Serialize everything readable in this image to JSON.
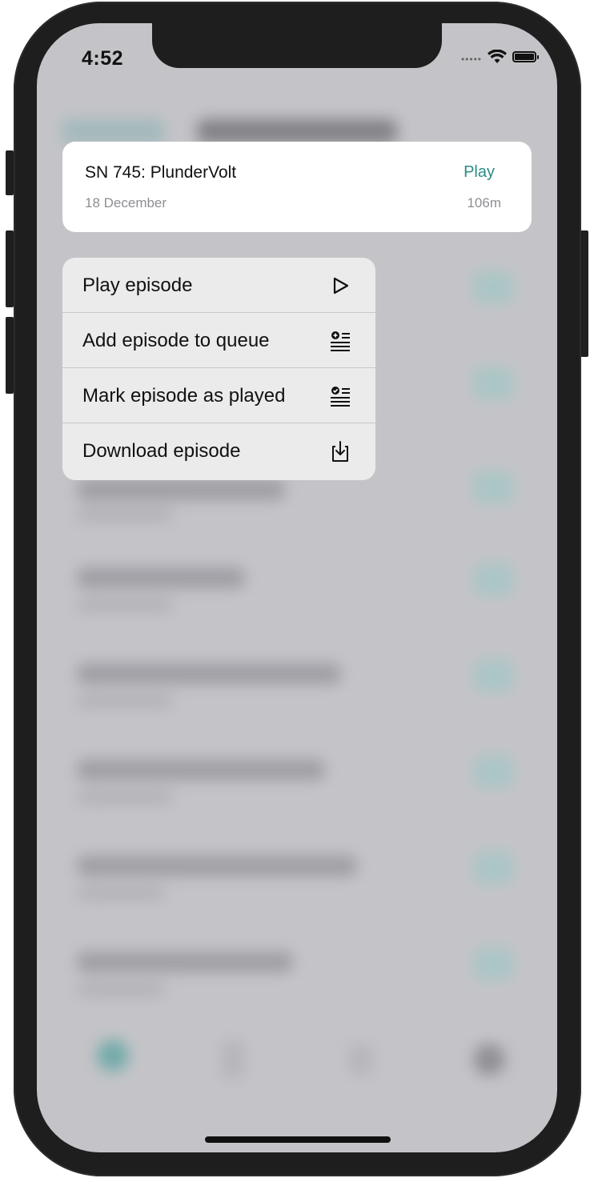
{
  "status_bar": {
    "time": "4:52",
    "signal_icon": "signal-dots-icon",
    "wifi_icon": "wifi-icon",
    "battery_icon": "battery-icon"
  },
  "preview": {
    "title": "SN 745: PlunderVolt",
    "date": "18 December",
    "play_label": "Play",
    "duration": "106m",
    "accent_color": "#2a8c86"
  },
  "menu": {
    "items": [
      {
        "label": "Play episode",
        "icon": "play-outline-icon"
      },
      {
        "label": "Add episode to queue",
        "icon": "add-to-queue-icon"
      },
      {
        "label": "Mark episode as played",
        "icon": "mark-played-icon"
      },
      {
        "label": "Download episode",
        "icon": "download-icon"
      }
    ]
  }
}
